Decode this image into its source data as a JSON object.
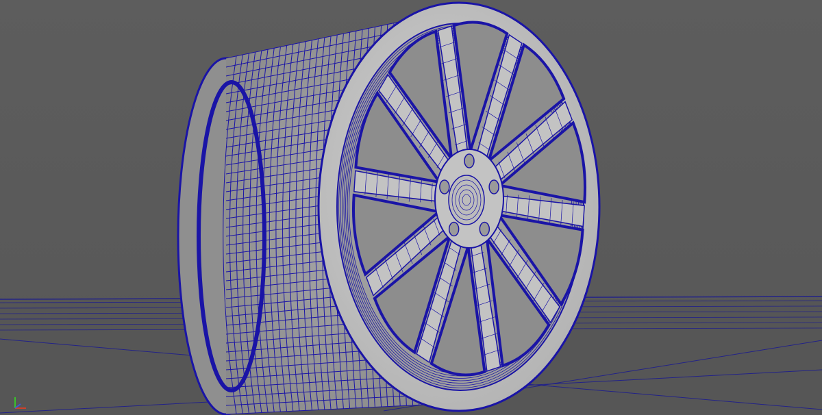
{
  "viewport": {
    "panel": "perspective-viewport",
    "colors": {
      "background": "#5b5b5b",
      "wireframe": "#1a14a6",
      "surface": "#c3c3c3",
      "surface_dark": "#8d8d8d",
      "grid": "#222288"
    },
    "object": "wheel-rim",
    "shading": "wireframe-on-shaded",
    "spoke_count": 10,
    "lug_count": 5
  },
  "gizmo": {
    "axes": [
      {
        "name": "x",
        "color": "#d0402a"
      },
      {
        "name": "y",
        "color": "#39c12a"
      },
      {
        "name": "z",
        "color": "#3a5ad8"
      }
    ]
  }
}
